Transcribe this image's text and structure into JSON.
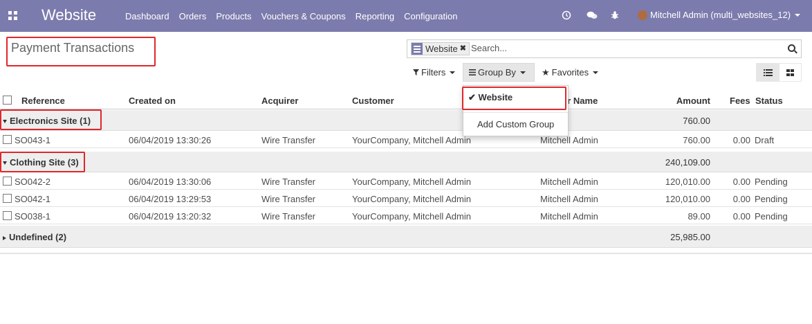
{
  "navbar": {
    "brand": "Website",
    "menu": [
      "Dashboard",
      "Orders",
      "Products",
      "Vouchers & Coupons",
      "Reporting",
      "Configuration"
    ],
    "user": "Mitchell Admin (multi_websites_12)",
    "icons": [
      "apps-icon",
      "clock-icon",
      "chat-icon",
      "bug-icon"
    ]
  },
  "control_panel": {
    "title": "Payment Transactions",
    "search": {
      "facet_label": "Website",
      "placeholder": "Search..."
    },
    "filters_label": "Filters",
    "group_by_label": "Group By",
    "favorites_label": "Favorites"
  },
  "group_by_menu": {
    "items": [
      "Website",
      "Add Custom Group"
    ],
    "selected": "Website"
  },
  "table": {
    "columns": [
      "Reference",
      "Created on",
      "Acquirer",
      "Customer",
      "Partner Name",
      "Amount",
      "Fees",
      "Status"
    ],
    "partner_col_visible": "er Name",
    "groups": [
      {
        "label": "Electronics Site (1)",
        "total": "760.00",
        "expanded": true,
        "rows": [
          {
            "reference": "SO043-1",
            "created_on": "06/04/2019 13:30:26",
            "acquirer": "Wire Transfer",
            "customer": "YourCompany, Mitchell Admin",
            "partner": "Mitchell Admin",
            "amount": "760.00",
            "fees": "0.00",
            "status": "Draft"
          }
        ]
      },
      {
        "label": "Clothing Site (3)",
        "total": "240,109.00",
        "expanded": true,
        "rows": [
          {
            "reference": "SO042-2",
            "created_on": "06/04/2019 13:30:06",
            "acquirer": "Wire Transfer",
            "customer": "YourCompany, Mitchell Admin",
            "partner": "Mitchell Admin",
            "amount": "120,010.00",
            "fees": "0.00",
            "status": "Pending"
          },
          {
            "reference": "SO042-1",
            "created_on": "06/04/2019 13:29:53",
            "acquirer": "Wire Transfer",
            "customer": "YourCompany, Mitchell Admin",
            "partner": "Mitchell Admin",
            "amount": "120,010.00",
            "fees": "0.00",
            "status": "Pending"
          },
          {
            "reference": "SO038-1",
            "created_on": "06/04/2019 13:20:32",
            "acquirer": "Wire Transfer",
            "customer": "YourCompany, Mitchell Admin",
            "partner": "Mitchell Admin",
            "amount": "89.00",
            "fees": "0.00",
            "status": "Pending"
          }
        ]
      },
      {
        "label": "Undefined (2)",
        "total": "25,985.00",
        "expanded": false,
        "rows": []
      }
    ]
  },
  "colors": {
    "navbar": "#7c7bad",
    "highlight": "#e0262b"
  }
}
